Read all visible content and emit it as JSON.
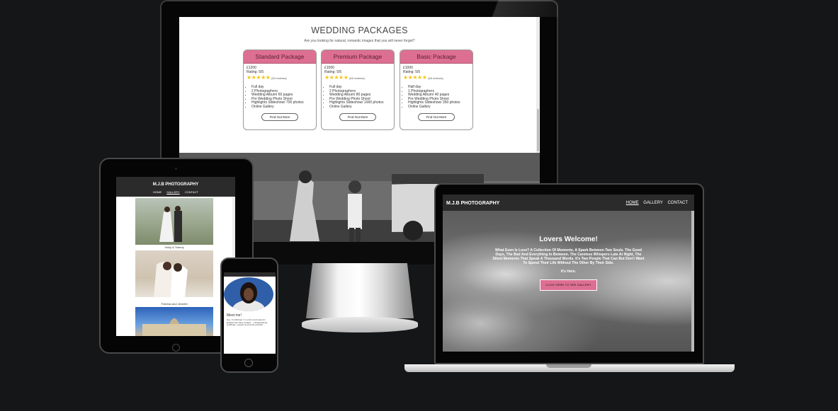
{
  "desktop": {
    "title": "WEDDING PACKAGES",
    "subtitle": "Are you looking for natural, romantic images that you will never forget?",
    "packages": [
      {
        "name": "Standard Package",
        "price": "£1200",
        "rating": "Rating: 5/5",
        "stars": "★★★★★",
        "reviews": "(53 reviews)",
        "features": [
          "Full day",
          "2 Photographers",
          "Wedding Album/ 60 pages",
          "Pre Wedding Photo Shoot",
          "Highlights Slideshow/ 700 photos",
          "Online Gallery"
        ],
        "button": "Find Out More"
      },
      {
        "name": "Premium Package",
        "price": "£1500",
        "rating": "Rating: 5/5",
        "stars": "★★★★★",
        "reviews": "(65 reviews)",
        "features": [
          "Full day",
          "2 Photographers",
          "Wedding Album/ 80 pages",
          "Pre Wedding Photo Shoot",
          "Highlights Slideshow/ 1000 photos",
          "Online Gallery"
        ],
        "button": "Find Out More"
      },
      {
        "name": "Basic Package",
        "price": "£1000",
        "rating": "Rating: 5/5",
        "stars": "★★★★★",
        "reviews": "(48 reviews)",
        "features": [
          "Half day",
          "1 Photographers",
          "Wedding Album/ 40 pages",
          "Pre Wedding Photo Shoot",
          "Highlights Slideshow/ 350 photos",
          "Online Gallery"
        ],
        "button": "Find Out More"
      }
    ]
  },
  "tablet": {
    "logo": "M.J.B PHOTOGRAPHY",
    "nav": [
      "HOME",
      "GALLERY",
      "CONTACT"
    ],
    "captions": [
      "Vicky & Tommy",
      "Theresa and Jennifer"
    ]
  },
  "phone": {
    "header": "",
    "meet": "Meet me!",
    "text": "Hey, I'm Michael. I'm a born and raised in England but have worked ... photographing weddings, couples and family portraits ..."
  },
  "laptop": {
    "logo": "M.J.B PHOTOGRAPHY",
    "nav": [
      "HOME",
      "GALLERY",
      "CONTACT"
    ],
    "hero_title": "Lovers Welcome!",
    "hero_text": "What Even Is Love? A Collection Of Moments, A Spark Between Two Souls. The Good Days, The Bad And Everything In Between. The Careless Whispers Late At Night, The Silent Moments That Speak A Thousand Words. It's Two People That Can But Don't Want To Spend Their Life Without The Other By Their Side.",
    "hero_here": "It's Here.",
    "hero_button": "CLICK HERE TO SEE GALLERY"
  },
  "colors": {
    "accent_pink": "#dd6f92",
    "header_dark": "#2b2b2b",
    "background": "#151618"
  }
}
